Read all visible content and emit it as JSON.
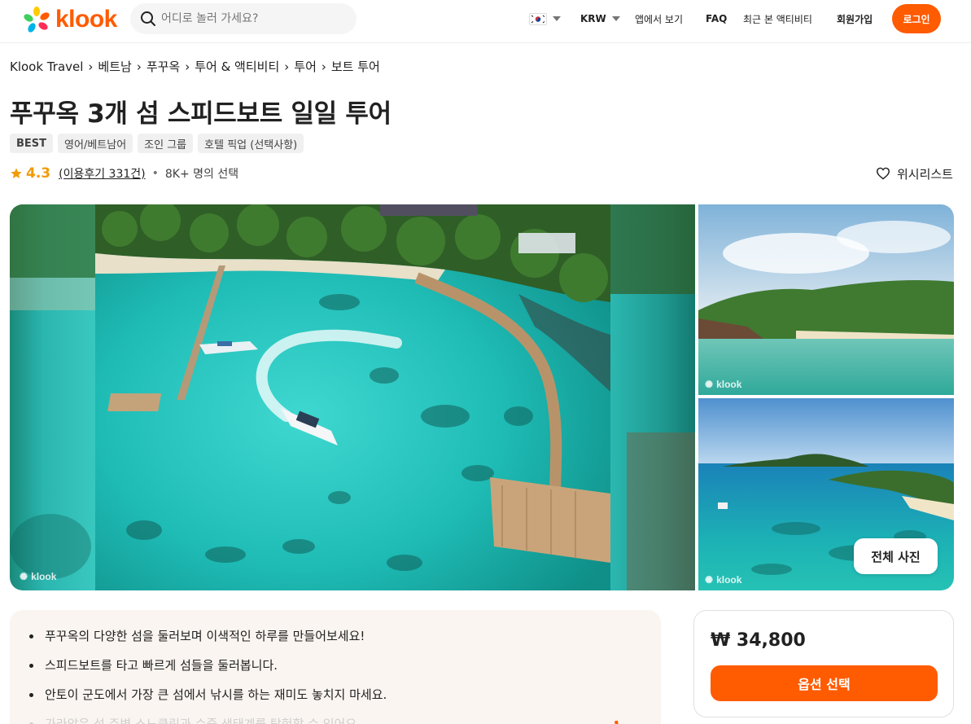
{
  "header": {
    "logo_text": "klook",
    "search_placeholder": "어디로 놀러 가세요?",
    "currency": "KRW",
    "app_link": "앱에서 보기",
    "faq": "FAQ",
    "recently_viewed": "최근 본 액티비티",
    "signup": "회원가입",
    "login": "로그인"
  },
  "breadcrumb": [
    "Klook Travel",
    "베트남",
    "푸꾸옥",
    "투어 & 액티비티",
    "투어",
    "보트 투어"
  ],
  "product": {
    "title": "푸꾸옥 3개 섬 스피드보트 일일 투어",
    "tags": [
      "BEST",
      "영어/베트남어",
      "조인 그룹",
      "호텔 픽업 (선택사항)"
    ],
    "rating": "4.3",
    "reviews": "(이용후기 331건)",
    "separator": "•",
    "booked": "8K+ 명의 선택",
    "wishlist": "위시리스트"
  },
  "gallery": {
    "watermark": "klook",
    "all_photos": "전체 사진"
  },
  "highlights": [
    "푸꾸옥의 다양한 섬을 둘러보며 이색적인 하루를 만들어보세요!",
    "스피드보트를 타고 빠르게 섬들을 둘러봅니다.",
    "안토이 군도에서 가장 큰 섬에서 낚시를 하는 재미도 놓치지 마세요.",
    "가라앉은 섬 주변 스노클링과 수중 생태계를 탐험할 수 있어요"
  ],
  "booking": {
    "price": "₩ 34,800",
    "select_option": "옵션 선택"
  },
  "colors": {
    "brand": "#ff5b00",
    "rating_star": "#f09b0a"
  }
}
